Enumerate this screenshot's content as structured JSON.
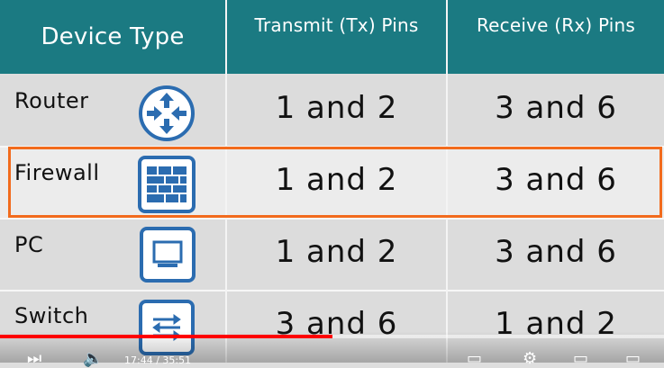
{
  "header": {
    "col1": "Device Type",
    "col2": "Transmit (Tx) Pins",
    "col3": "Receive (Rx) Pins"
  },
  "rows": [
    {
      "device": "Router",
      "tx": "1 and 2",
      "rx": "3 and 6",
      "icon": "router-icon"
    },
    {
      "device": "Firewall",
      "tx": "1 and 2",
      "rx": "3 and 6",
      "icon": "firewall-icon",
      "highlighted": true
    },
    {
      "device": "PC",
      "tx": "1 and 2",
      "rx": "3 and 6",
      "icon": "pc-icon"
    },
    {
      "device": "Switch",
      "tx": "3 and 6",
      "rx": "1 and 2",
      "icon": "switch-icon"
    }
  ],
  "player": {
    "progress_fraction": 0.5,
    "time_text": "17:44 / 35:51"
  },
  "colors": {
    "header_bg": "#1b7a82",
    "highlight_border": "#f26b1d",
    "icon_blue": "#2b6cb0",
    "progress": "#ff0000"
  }
}
